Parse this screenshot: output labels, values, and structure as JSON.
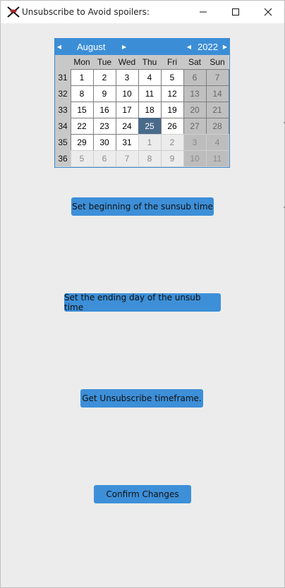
{
  "window": {
    "title": "Unsubscribe to Avoid spoilers:",
    "icon": "red-x-app-icon",
    "controls": [
      "minimize-icon",
      "maximize-icon",
      "close-icon"
    ]
  },
  "calendar": {
    "month": "August",
    "year": "2022",
    "day_headers": [
      "Mon",
      "Tue",
      "Wed",
      "Thu",
      "Fri",
      "Sat",
      "Sun"
    ],
    "weeks": [
      {
        "week": "31",
        "days": [
          "1",
          "2",
          "3",
          "4",
          "5",
          "6",
          "7"
        ]
      },
      {
        "week": "32",
        "days": [
          "8",
          "9",
          "10",
          "11",
          "12",
          "13",
          "14"
        ]
      },
      {
        "week": "33",
        "days": [
          "15",
          "16",
          "17",
          "18",
          "19",
          "20",
          "21"
        ]
      },
      {
        "week": "34",
        "days": [
          "22",
          "23",
          "24",
          "25",
          "26",
          "27",
          "28"
        ]
      },
      {
        "week": "35",
        "days": [
          "29",
          "30",
          "31",
          "1",
          "2",
          "3",
          "4"
        ]
      },
      {
        "week": "36",
        "days": [
          "5",
          "6",
          "7",
          "8",
          "9",
          "10",
          "11"
        ]
      }
    ],
    "selected_day": "25",
    "header_color": "#3b8ed6",
    "selected_color": "#4a6a8a"
  },
  "buttons": {
    "set_beginning": "Set beginning of the sunsub time",
    "set_ending": "Set the ending day of the unsub time",
    "get_timeframe": "Get Unsubscribe timeframe.",
    "confirm": "Confirm Changes",
    "color": "#3d8fd8"
  }
}
